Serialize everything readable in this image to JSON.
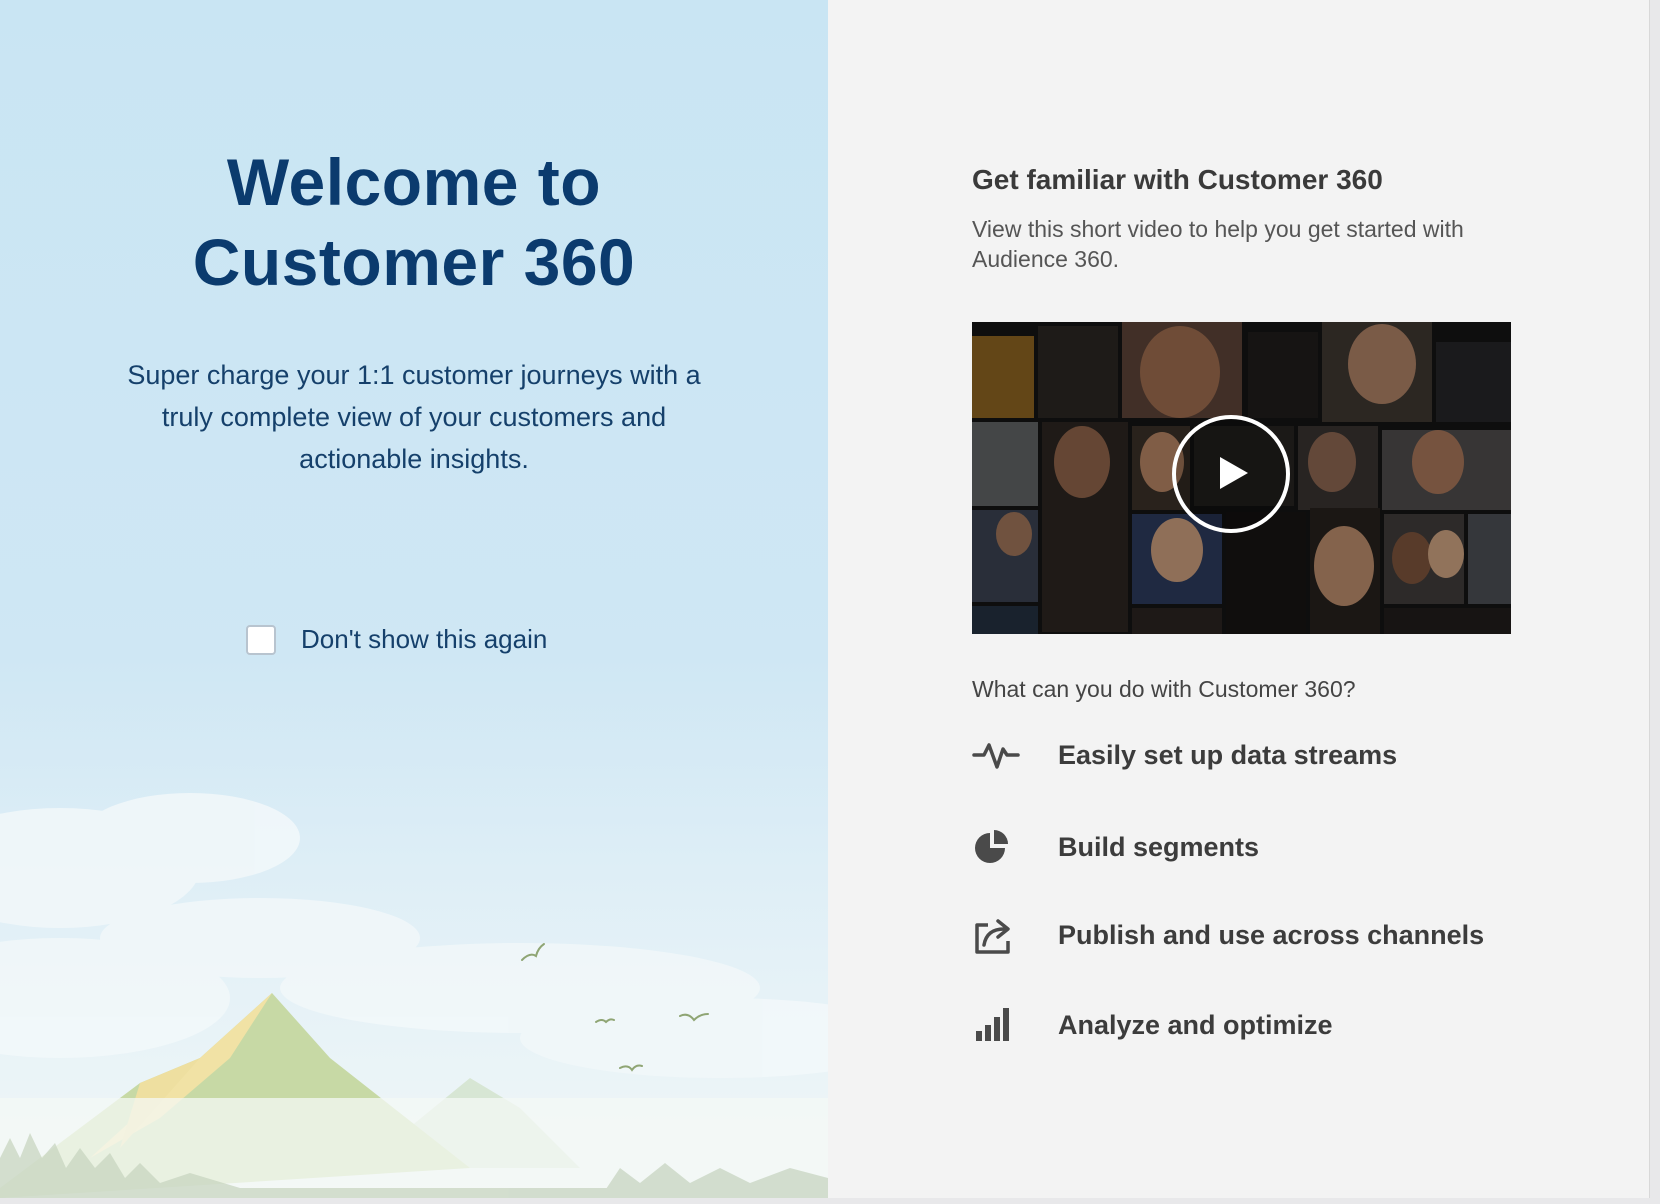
{
  "welcome": {
    "title_line1": "Welcome to",
    "title_line2": "Customer 360",
    "subtitle": "Super charge your 1:1 customer journeys with a truly complete view of your customers and actionable insights.",
    "checkbox_label": "Don't show this again",
    "checkbox_checked": false
  },
  "intro": {
    "title": "Get familiar with Customer 360",
    "description": "View this short video to help you get started with Audience 360."
  },
  "video": {
    "play_icon": "play-icon"
  },
  "capabilities": {
    "question": "What can you do with Customer 360?",
    "items": [
      {
        "label": "Easily set up data streams",
        "icon": "pulse-icon"
      },
      {
        "label": "Build segments",
        "icon": "pie-chart-icon"
      },
      {
        "label": "Publish and use across channels",
        "icon": "share-icon"
      },
      {
        "label": "Analyze and optimize",
        "icon": "bar-chart-icon"
      }
    ]
  },
  "colors": {
    "title": "#0b3b6e",
    "left_background": "#c9e5f3",
    "right_background": "#f3f3f3",
    "feature_text": "#3c3c3c"
  }
}
